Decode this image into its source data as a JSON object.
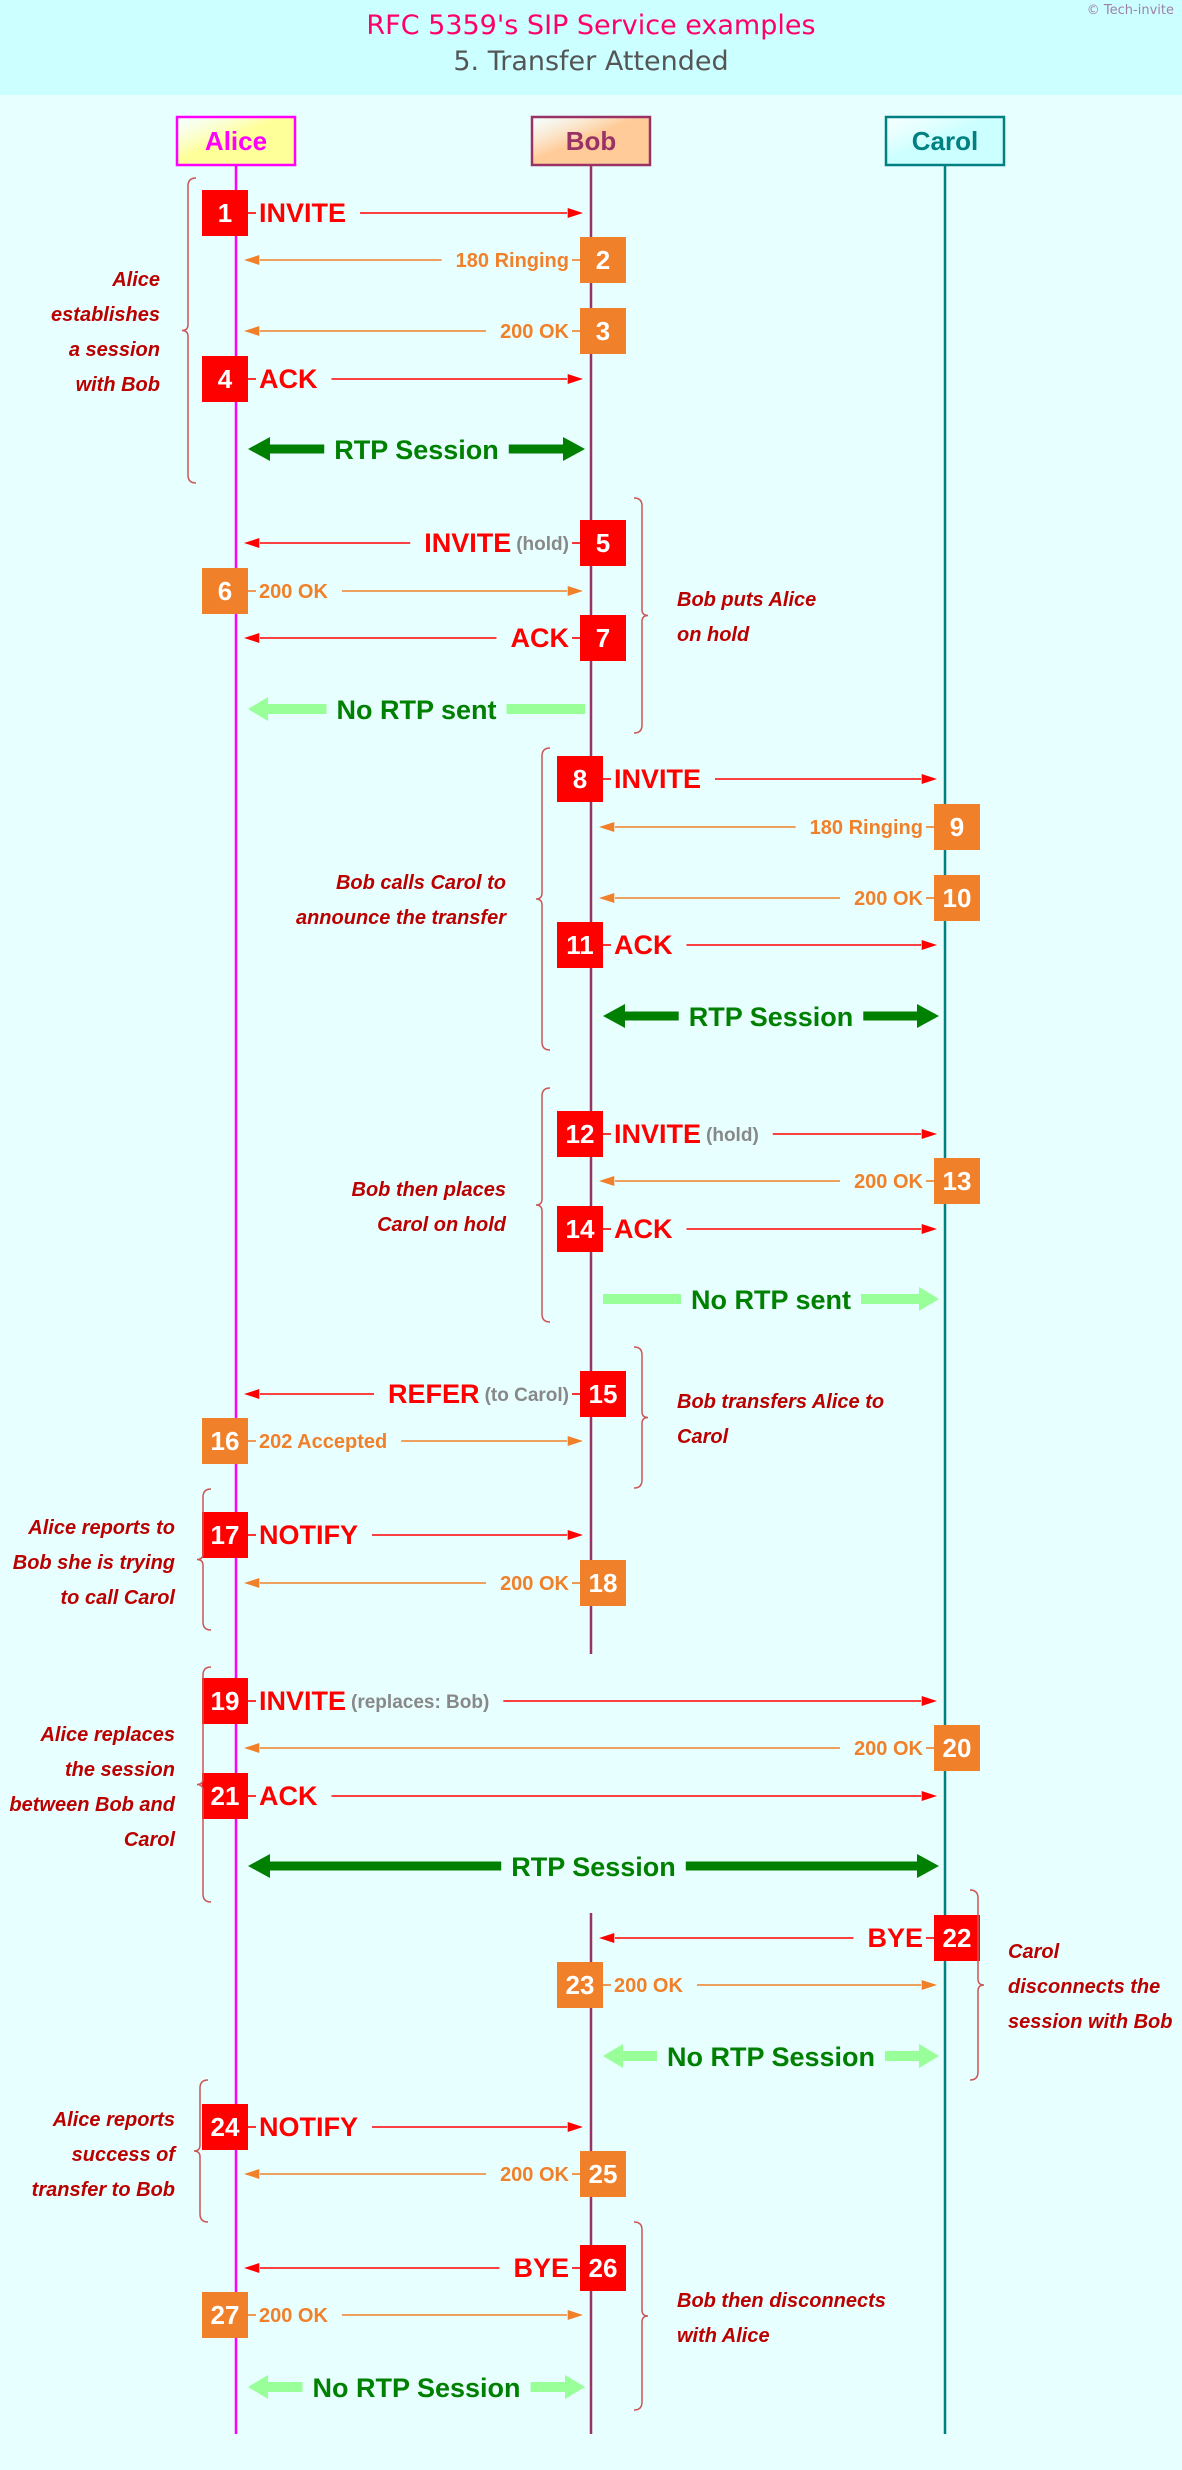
{
  "header": {
    "title": "RFC 5359's SIP Service examples",
    "subtitle": "5. Transfer Attended",
    "copyright": "© Tech-invite"
  },
  "colors": {
    "header_bg": "#ccffff",
    "page_bg": "#e8ffff",
    "request": "#ff0000",
    "response": "#f0802a",
    "rtp_active": "#008000",
    "rtp_inactive": "#99ff99",
    "note_text": "#bb0000",
    "qualifier": "#888888"
  },
  "actors": [
    {
      "id": "alice",
      "label": "Alice",
      "text_color": "#ff00ff",
      "border_color": "#ff00ff",
      "fill": "#ffff99",
      "line_color": "#ff00ff"
    },
    {
      "id": "bob",
      "label": "Bob",
      "text_color": "#993366",
      "border_color": "#993366",
      "fill": "#ffcc99",
      "line_color": "#993366"
    },
    {
      "id": "carol",
      "label": "Carol",
      "text_color": "#008080",
      "border_color": "#008080",
      "fill": "#ccffff",
      "line_color": "#008080"
    }
  ],
  "events": [
    {
      "type": "msg",
      "step": 1,
      "from": "alice",
      "to": "bob",
      "kind": "request",
      "label": "INVITE",
      "qualifier": ""
    },
    {
      "type": "msg",
      "step": 2,
      "from": "bob",
      "to": "alice",
      "kind": "response",
      "label": "180 Ringing",
      "qualifier": ""
    },
    {
      "type": "msg",
      "step": 3,
      "from": "bob",
      "to": "alice",
      "kind": "response",
      "label": "200 OK",
      "qualifier": ""
    },
    {
      "type": "msg",
      "step": 4,
      "from": "alice",
      "to": "bob",
      "kind": "request",
      "label": "ACK",
      "qualifier": ""
    },
    {
      "type": "rtp",
      "from": "alice",
      "to": "bob",
      "active": true,
      "direction": "both",
      "label": "RTP Session"
    },
    {
      "type": "msg",
      "step": 5,
      "from": "bob",
      "to": "alice",
      "kind": "request",
      "label": "INVITE",
      "qualifier": "(hold)"
    },
    {
      "type": "msg",
      "step": 6,
      "from": "alice",
      "to": "bob",
      "kind": "response",
      "label": "200 OK",
      "qualifier": ""
    },
    {
      "type": "msg",
      "step": 7,
      "from": "bob",
      "to": "alice",
      "kind": "request",
      "label": "ACK",
      "qualifier": ""
    },
    {
      "type": "rtp",
      "from": "bob",
      "to": "alice",
      "active": false,
      "direction": "to",
      "label": "No RTP sent"
    },
    {
      "type": "msg",
      "step": 8,
      "from": "bob",
      "to": "carol",
      "kind": "request",
      "label": "INVITE",
      "qualifier": ""
    },
    {
      "type": "msg",
      "step": 9,
      "from": "carol",
      "to": "bob",
      "kind": "response",
      "label": "180 Ringing",
      "qualifier": ""
    },
    {
      "type": "msg",
      "step": 10,
      "from": "carol",
      "to": "bob",
      "kind": "response",
      "label": "200 OK",
      "qualifier": ""
    },
    {
      "type": "msg",
      "step": 11,
      "from": "bob",
      "to": "carol",
      "kind": "request",
      "label": "ACK",
      "qualifier": ""
    },
    {
      "type": "rtp",
      "from": "bob",
      "to": "carol",
      "active": true,
      "direction": "both",
      "label": "RTP Session"
    },
    {
      "type": "msg",
      "step": 12,
      "from": "bob",
      "to": "carol",
      "kind": "request",
      "label": "INVITE",
      "qualifier": "(hold)"
    },
    {
      "type": "msg",
      "step": 13,
      "from": "carol",
      "to": "bob",
      "kind": "response",
      "label": "200 OK",
      "qualifier": ""
    },
    {
      "type": "msg",
      "step": 14,
      "from": "bob",
      "to": "carol",
      "kind": "request",
      "label": "ACK",
      "qualifier": ""
    },
    {
      "type": "rtp",
      "from": "bob",
      "to": "carol",
      "active": false,
      "direction": "to",
      "label": "No RTP sent"
    },
    {
      "type": "msg",
      "step": 15,
      "from": "bob",
      "to": "alice",
      "kind": "request",
      "label": "REFER",
      "qualifier": "(to Carol)"
    },
    {
      "type": "msg",
      "step": 16,
      "from": "alice",
      "to": "bob",
      "kind": "response",
      "label": "202 Accepted",
      "qualifier": ""
    },
    {
      "type": "msg",
      "step": 17,
      "from": "alice",
      "to": "bob",
      "kind": "request",
      "label": "NOTIFY",
      "qualifier": ""
    },
    {
      "type": "msg",
      "step": 18,
      "from": "bob",
      "to": "alice",
      "kind": "response",
      "label": "200 OK",
      "qualifier": ""
    },
    {
      "type": "msg",
      "step": 19,
      "from": "alice",
      "to": "carol",
      "kind": "request",
      "label": "INVITE",
      "qualifier": "(replaces: Bob)"
    },
    {
      "type": "msg",
      "step": 20,
      "from": "carol",
      "to": "alice",
      "kind": "response",
      "label": "200 OK",
      "qualifier": ""
    },
    {
      "type": "msg",
      "step": 21,
      "from": "alice",
      "to": "carol",
      "kind": "request",
      "label": "ACK",
      "qualifier": ""
    },
    {
      "type": "rtp",
      "from": "alice",
      "to": "carol",
      "active": true,
      "direction": "both",
      "label": "RTP Session"
    },
    {
      "type": "msg",
      "step": 22,
      "from": "carol",
      "to": "bob",
      "kind": "request",
      "label": "BYE",
      "qualifier": ""
    },
    {
      "type": "msg",
      "step": 23,
      "from": "bob",
      "to": "carol",
      "kind": "response",
      "label": "200 OK",
      "qualifier": ""
    },
    {
      "type": "rtp",
      "from": "bob",
      "to": "carol",
      "active": false,
      "direction": "both",
      "label": "No RTP Session"
    },
    {
      "type": "msg",
      "step": 24,
      "from": "alice",
      "to": "bob",
      "kind": "request",
      "label": "NOTIFY",
      "qualifier": ""
    },
    {
      "type": "msg",
      "step": 25,
      "from": "bob",
      "to": "alice",
      "kind": "response",
      "label": "200 OK",
      "qualifier": ""
    },
    {
      "type": "msg",
      "step": 26,
      "from": "bob",
      "to": "alice",
      "kind": "request",
      "label": "BYE",
      "qualifier": ""
    },
    {
      "type": "msg",
      "step": 27,
      "from": "alice",
      "to": "bob",
      "kind": "response",
      "label": "200 OK",
      "qualifier": ""
    },
    {
      "type": "rtp",
      "from": "alice",
      "to": "bob",
      "active": false,
      "direction": "both",
      "label": "No RTP Session"
    }
  ],
  "notes": [
    {
      "side": "left-of-alice",
      "steps": "1-4",
      "lines": [
        "Alice",
        "establishes",
        "a session",
        "with Bob"
      ]
    },
    {
      "side": "right-of-bob",
      "steps": "5-7",
      "lines": [
        "Bob puts Alice",
        "on hold"
      ]
    },
    {
      "side": "left-of-bob",
      "steps": "8-11",
      "lines": [
        "Bob calls Carol to",
        "announce the transfer"
      ]
    },
    {
      "side": "left-of-bob",
      "steps": "12-14",
      "lines": [
        "Bob then places",
        "Carol on hold"
      ]
    },
    {
      "side": "right-of-bob",
      "steps": "15-16",
      "lines": [
        "Bob transfers Alice to",
        "Carol"
      ]
    },
    {
      "side": "left-of-alice",
      "steps": "17-18",
      "lines": [
        "Alice reports to",
        "Bob she is trying",
        "to call Carol"
      ]
    },
    {
      "side": "left-of-alice",
      "steps": "19-21",
      "lines": [
        "Alice replaces",
        "the session",
        "between Bob and",
        "Carol"
      ]
    },
    {
      "side": "right-of-carol",
      "steps": "22-23",
      "lines": [
        "Carol",
        "disconnects the",
        "session with Bob"
      ]
    },
    {
      "side": "left-of-alice",
      "steps": "24-25",
      "lines": [
        "Alice reports",
        "success of",
        "transfer to Bob"
      ]
    },
    {
      "side": "right-of-bob",
      "steps": "26-27",
      "lines": [
        "Bob then disconnects",
        "with Alice"
      ]
    }
  ]
}
